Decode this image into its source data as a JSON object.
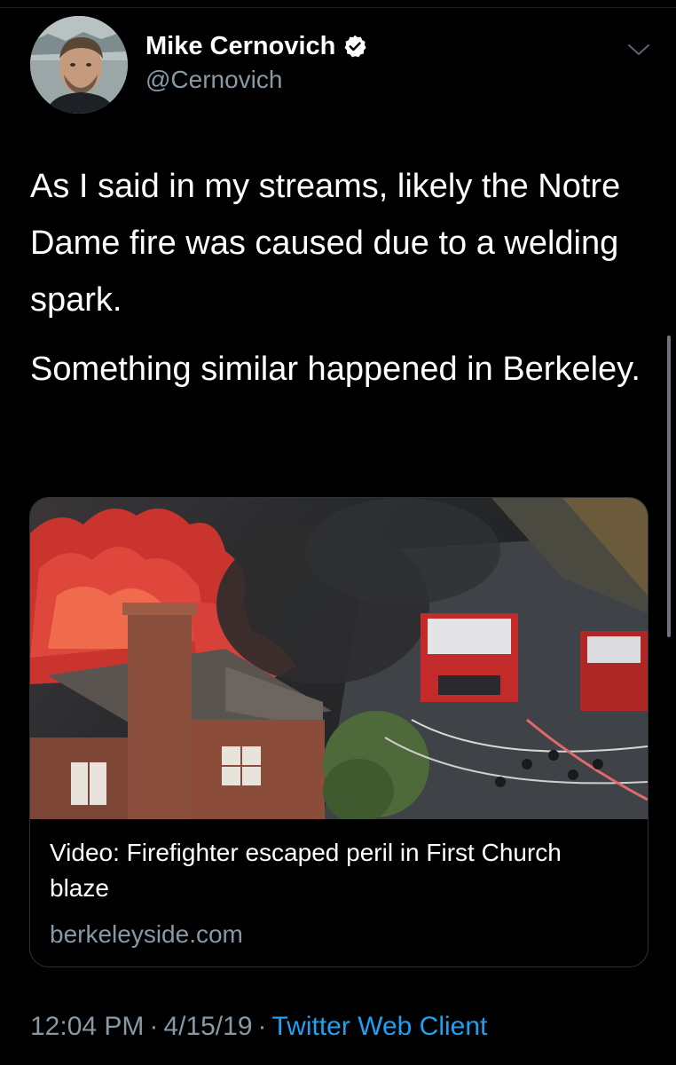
{
  "colors": {
    "background": "#000000",
    "primary_text": "#ffffff",
    "secondary_text": "#8899a6",
    "link": "#1da1f2",
    "verified_badge": "#ffffff"
  },
  "icons": {
    "verified": "verified-badge-icon",
    "more": "chevron-down-icon"
  },
  "author": {
    "display_name": "Mike Cernovich",
    "handle": "@Cernovich",
    "verified": true
  },
  "tweet": {
    "paragraphs": [
      "As I said in my streams, likely the Notre Dame fire was caused due to a welding spark.",
      "Something similar happened in Berkeley."
    ]
  },
  "link_card": {
    "title": "Video: Firefighter escaped peril in First Church blaze",
    "domain": "berkeleyside.com"
  },
  "meta": {
    "time": "12:04 PM",
    "date": "4/15/19",
    "separator": "·",
    "source": "Twitter Web Client"
  }
}
